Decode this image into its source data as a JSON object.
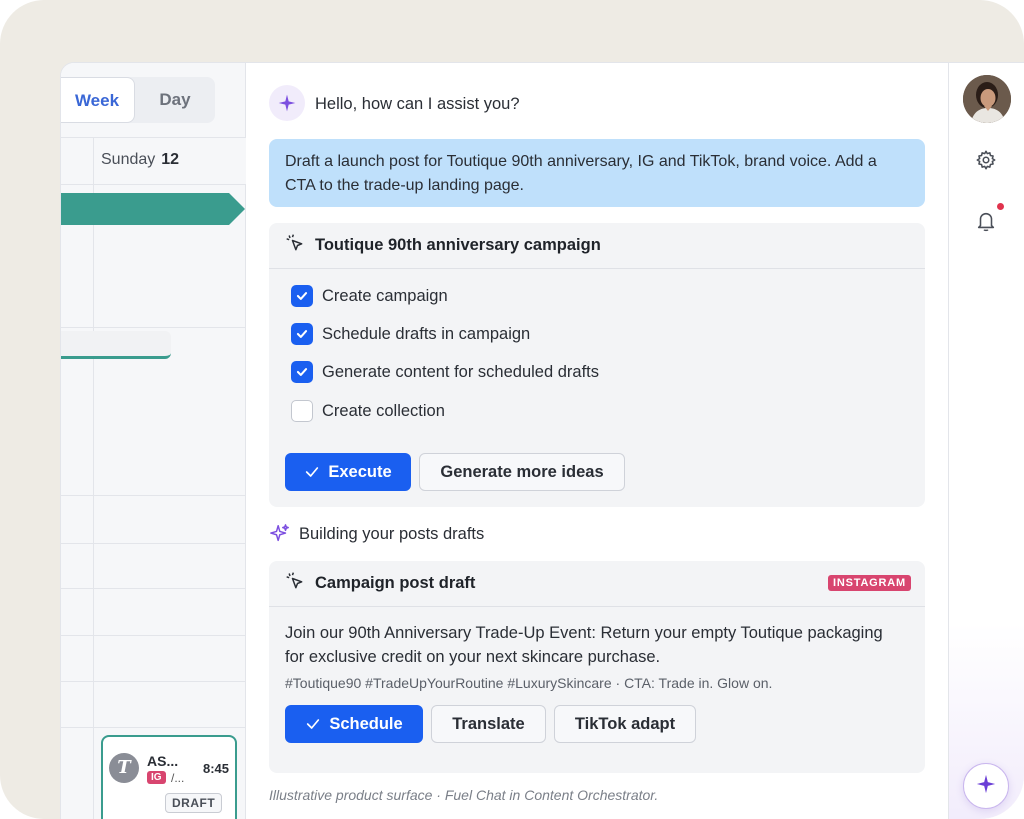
{
  "calendar": {
    "tab_week": "Week",
    "tab_day": "Day",
    "day_name": "Sunday",
    "day_number": "12",
    "post": {
      "name": "AS...",
      "platform": "IG",
      "more": "/...",
      "time": "8:45",
      "status": "DRAFT"
    }
  },
  "chat": {
    "greeting": "Hello, how can I assist you?",
    "user_message": "Draft a launch post for Toutique 90th anniversary, IG and TikTok, brand voice. Add a CTA to the trade-up landing page.",
    "plan_card": {
      "title": "Toutique 90th anniversary campaign",
      "tasks": [
        {
          "label": "Create campaign",
          "checked": true
        },
        {
          "label": "Schedule drafts in campaign",
          "checked": true
        },
        {
          "label": "Generate content for scheduled drafts",
          "checked": true
        },
        {
          "label": "Create collection",
          "checked": false
        }
      ],
      "execute_label": "Execute",
      "more_ideas_label": "Generate more ideas"
    },
    "status_text": "Building your posts drafts",
    "draft_card": {
      "title": "Campaign post draft",
      "platform_badge": "INSTAGRAM",
      "body": "Join our 90th Anniversary Trade-Up Event: Return your empty Toutique packaging for exclusive credit on your next skincare purchase.",
      "hashtags": "#Toutique90 #TradeUpYourRoutine #LuxurySkincare · CTA: Trade in. Glow on.",
      "schedule_label": "Schedule",
      "translate_label": "Translate",
      "tiktok_label": "TikTok adapt"
    },
    "footnote": "Illustrative product surface · Fuel Chat in Content Orchestrator."
  },
  "colors": {
    "primary": "#1a5ff0",
    "teal": "#3a9c8e",
    "instagram": "#d8456f",
    "user_bubble": "#bfe0fb"
  }
}
